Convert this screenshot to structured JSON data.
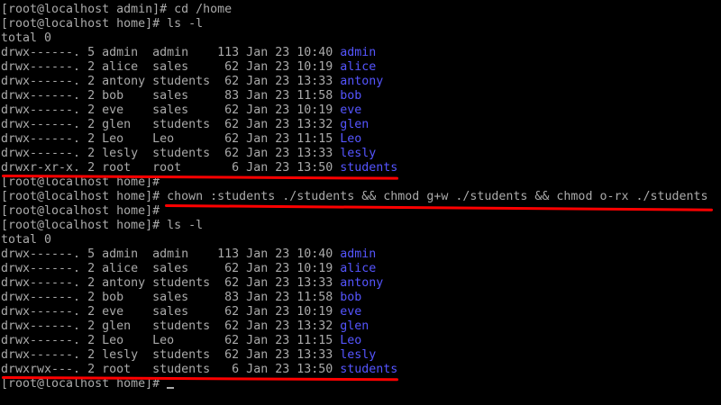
{
  "colors": {
    "background": "#000000",
    "text": "#aaaaaa",
    "directory": "#5555ff",
    "annotation": "#ff0000"
  },
  "lines": [
    {
      "type": "prompt",
      "prompt": "[root@localhost admin]# ",
      "command": "cd /home"
    },
    {
      "type": "prompt",
      "prompt": "[root@localhost home]# ",
      "command": "ls -l"
    },
    {
      "type": "text",
      "text": "total 0"
    },
    {
      "type": "entry",
      "meta": "drwx------. 5 admin  admin    113 Jan 23 10:40 ",
      "name": "admin"
    },
    {
      "type": "entry",
      "meta": "drwx------. 2 alice  sales     62 Jan 23 10:19 ",
      "name": "alice"
    },
    {
      "type": "entry",
      "meta": "drwx------. 2 antony students  62 Jan 23 13:33 ",
      "name": "antony"
    },
    {
      "type": "entry",
      "meta": "drwx------. 2 bob    sales     83 Jan 23 11:58 ",
      "name": "bob"
    },
    {
      "type": "entry",
      "meta": "drwx------. 2 eve    sales     62 Jan 23 10:19 ",
      "name": "eve"
    },
    {
      "type": "entry",
      "meta": "drwx------. 2 glen   students  62 Jan 23 13:32 ",
      "name": "glen"
    },
    {
      "type": "entry",
      "meta": "drwx------. 2 Leo    Leo       62 Jan 23 11:15 ",
      "name": "Leo"
    },
    {
      "type": "entry",
      "meta": "drwx------. 2 lesly  students  62 Jan 23 13:33 ",
      "name": "lesly"
    },
    {
      "type": "entry",
      "meta": "drwxr-xr-x. 2 root   root       6 Jan 23 13:50 ",
      "name": "students"
    },
    {
      "type": "prompt",
      "prompt": "[root@localhost home]# ",
      "command": ""
    },
    {
      "type": "prompt",
      "prompt": "[root@localhost home]# ",
      "command": "chown :students ./students && chmod g+w ./students && chmod o-rx ./students"
    },
    {
      "type": "prompt",
      "prompt": "[root@localhost home]# ",
      "command": ""
    },
    {
      "type": "prompt",
      "prompt": "[root@localhost home]# ",
      "command": "ls -l"
    },
    {
      "type": "text",
      "text": "total 0"
    },
    {
      "type": "entry",
      "meta": "drwx------. 5 admin  admin    113 Jan 23 10:40 ",
      "name": "admin"
    },
    {
      "type": "entry",
      "meta": "drwx------. 2 alice  sales     62 Jan 23 10:19 ",
      "name": "alice"
    },
    {
      "type": "entry",
      "meta": "drwx------. 2 antony students  62 Jan 23 13:33 ",
      "name": "antony"
    },
    {
      "type": "entry",
      "meta": "drwx------. 2 bob    sales     83 Jan 23 11:58 ",
      "name": "bob"
    },
    {
      "type": "entry",
      "meta": "drwx------. 2 eve    sales     62 Jan 23 10:19 ",
      "name": "eve"
    },
    {
      "type": "entry",
      "meta": "drwx------. 2 glen   students  62 Jan 23 13:32 ",
      "name": "glen"
    },
    {
      "type": "entry",
      "meta": "drwx------. 2 Leo    Leo       62 Jan 23 11:15 ",
      "name": "Leo"
    },
    {
      "type": "entry",
      "meta": "drwx------. 2 lesly  students  62 Jan 23 13:33 ",
      "name": "lesly"
    },
    {
      "type": "entry",
      "meta": "drwxrwx---. 2 root   students   6 Jan 23 13:50 ",
      "name": "students"
    },
    {
      "type": "prompt",
      "prompt": "[root@localhost home]# ",
      "command": "",
      "cursor": true
    }
  ]
}
